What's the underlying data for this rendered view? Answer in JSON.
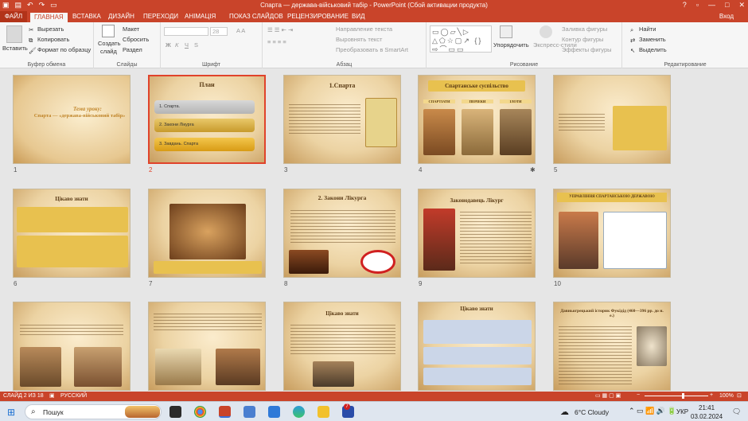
{
  "window": {
    "title": "Спарта — держава-військовий табір - PowerPoint (Сбой активации продукта)",
    "user": "Вход"
  },
  "tabs": [
    "ФАЙЛ",
    "ГЛАВНАЯ",
    "ВСТАВКА",
    "ДИЗАЙН",
    "ПЕРЕХОДИ",
    "АНІМАЦІЯ",
    "ПОКАЗ СЛАЙДОВ",
    "РЕЦЕНЗИРОВАНИЕ",
    "ВИД"
  ],
  "ribbon": {
    "clipboard": {
      "paste": "Вставить",
      "cut": "Вырезать",
      "copy": "Копировать",
      "format": "Формат по образцу",
      "label": "Буфер обмена"
    },
    "slides": {
      "create": "Создать",
      "slide": "слайд",
      "layout": "Макет",
      "reset": "Сбросить",
      "section": "Раздел",
      "label": "Слайды"
    },
    "font": {
      "size": "28",
      "label": "Шрифт"
    },
    "paragraph": {
      "direction": "Направление текста",
      "align": "Выровнять текст",
      "smartart": "Преобразовать в SmartArt",
      "label": "Абзац"
    },
    "drawing": {
      "arrange": "Упорядочить",
      "styles": "Экспресс-стили",
      "fill": "Заливка фигуры",
      "outline": "Контур фигуры",
      "effects": "Эффекты фигуры",
      "label": "Рисование"
    },
    "editing": {
      "find": "Найти",
      "replace": "Заменить",
      "select": "Выделить",
      "label": "Редактирование"
    }
  },
  "slides": [
    {
      "n": "1",
      "title": "Тема уроку:",
      "subtitle": "Спарта — «держава-військовий табір»"
    },
    {
      "n": "2",
      "title": "План",
      "items": [
        "1. Спарта.",
        "2. Закони Лікурга",
        "3. Завдань. Спарта"
      ]
    },
    {
      "n": "3",
      "title": "1.Спарта"
    },
    {
      "n": "4",
      "title": "Спартанське суспільство",
      "cols": [
        "СПАРТІАТИ",
        "ПЕРІЕКИ",
        "ІЛОТИ"
      ]
    },
    {
      "n": "5"
    },
    {
      "n": "6",
      "title": "Цікаво знати"
    },
    {
      "n": "7"
    },
    {
      "n": "8",
      "title": "2. Закони Лікурга"
    },
    {
      "n": "9",
      "title": "Законодавець Лікург"
    },
    {
      "n": "10",
      "title": "УПРАВЛІННЯ СПАРТАНСЬКОЮ ДЕРЖАВОЮ"
    },
    {
      "n": ""
    },
    {
      "n": ""
    },
    {
      "n": "",
      "title": "Цікаво знати"
    },
    {
      "n": "",
      "title": "Цікаво знати"
    },
    {
      "n": "",
      "title": "Давньогрецький історик Фукідід (460—396 рр. до н. е.)"
    }
  ],
  "status": {
    "slide": "СЛАЙД 2 ИЗ 18",
    "lang": "РУССКИЙ",
    "zoom": "100%"
  },
  "taskbar": {
    "search": "Пошук",
    "weather": "6°C  Cloudy",
    "lang": "УКР",
    "time": "21:41",
    "date": "03.02.2024"
  }
}
